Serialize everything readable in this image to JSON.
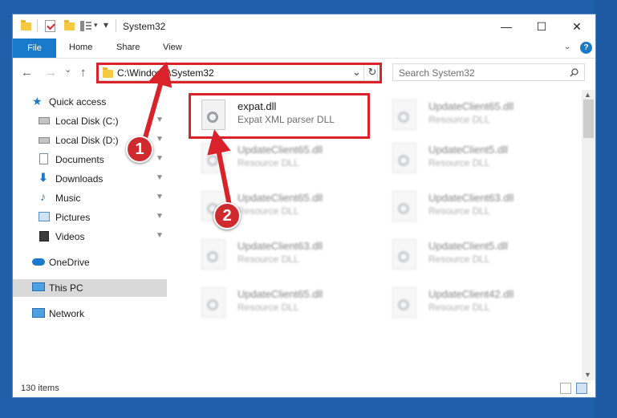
{
  "window": {
    "title": "System32"
  },
  "controls": {
    "minimize": "—",
    "maximize": "☐",
    "close": "✕"
  },
  "ribbon": {
    "tabs": [
      "File",
      "Home",
      "Share",
      "View"
    ]
  },
  "nav": {
    "back": "←",
    "forward": "→",
    "recent": "⌄",
    "up": "↑"
  },
  "address": {
    "path": "C:\\Windows\\System32",
    "dropdown": "⌄",
    "refresh": "↻"
  },
  "search": {
    "placeholder": "Search System32",
    "icon": "search-icon"
  },
  "sidebar": {
    "items": [
      {
        "label": "Quick access",
        "icon": "star-icon",
        "pinned": false
      },
      {
        "label": "Local Disk (C:)",
        "icon": "drive-icon",
        "pinned": true
      },
      {
        "label": "Local Disk (D:)",
        "icon": "drive-icon",
        "pinned": true
      },
      {
        "label": "Documents",
        "icon": "documents-icon",
        "pinned": true
      },
      {
        "label": "Downloads",
        "icon": "download-icon",
        "pinned": true
      },
      {
        "label": "Music",
        "icon": "music-icon",
        "pinned": true
      },
      {
        "label": "Pictures",
        "icon": "pictures-icon",
        "pinned": true
      },
      {
        "label": "Videos",
        "icon": "videos-icon",
        "pinned": true
      },
      {
        "label": "OneDrive",
        "icon": "cloud-icon",
        "pinned": false
      },
      {
        "label": "This PC",
        "icon": "computer-icon",
        "pinned": false,
        "selected": true
      },
      {
        "label": "Network",
        "icon": "network-icon",
        "pinned": false
      }
    ],
    "pin_glyph": "📌"
  },
  "files": [
    {
      "name": "expat.dll",
      "desc": "Expat XML parser DLL"
    },
    {
      "name": "UpdateClient65.dll",
      "desc": "Resource DLL"
    },
    {
      "name": "UpdateClient65.dll",
      "desc": "Resource DLL"
    },
    {
      "name": "UpdateClient5.dll",
      "desc": "Resource DLL"
    },
    {
      "name": "UpdateClient65.dll",
      "desc": "Resource DLL"
    },
    {
      "name": "UpdateClient63.dll",
      "desc": "Resource DLL"
    },
    {
      "name": "UpdateClient63.dll",
      "desc": "Resource DLL"
    },
    {
      "name": "UpdateClient5.dll",
      "desc": "Resource DLL"
    },
    {
      "name": "UpdateClient65.dll",
      "desc": "Resource DLL"
    },
    {
      "name": "UpdateClient42.dll",
      "desc": "Resource DLL"
    }
  ],
  "status": {
    "count": "130 items"
  },
  "callouts": {
    "step1": "1",
    "step2": "2"
  },
  "colors": {
    "highlight": "#d9222a",
    "badge": "#cf2a2e",
    "file_tab": "#1979ca",
    "desktop": "#1f5ea8"
  }
}
